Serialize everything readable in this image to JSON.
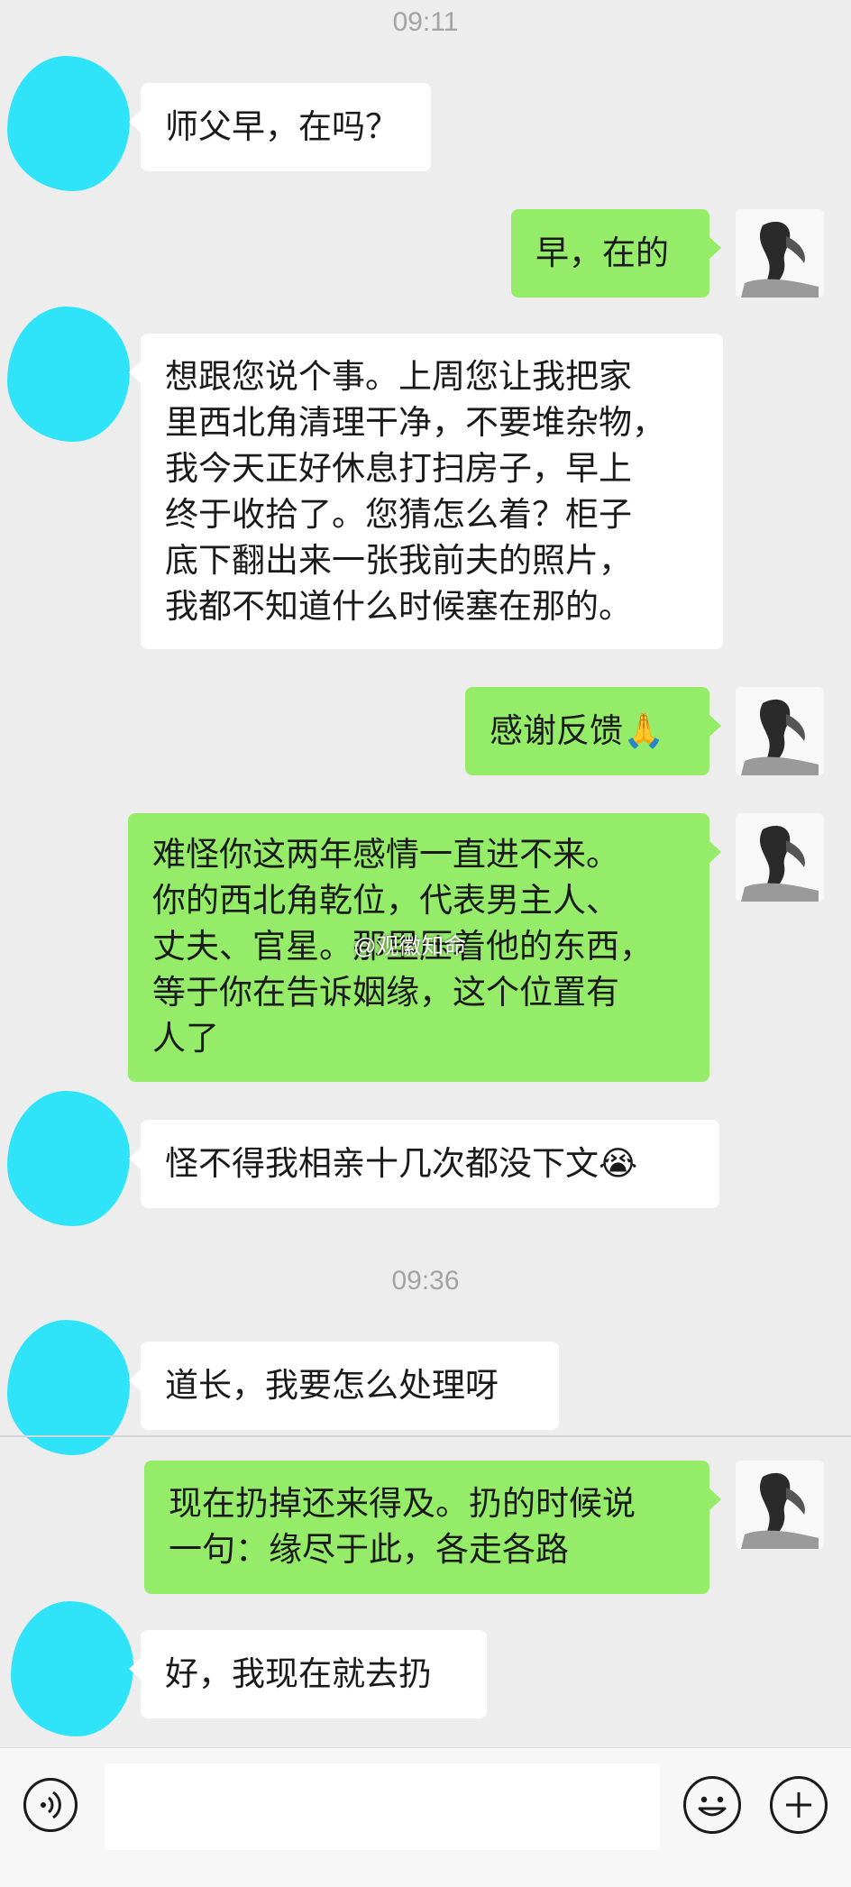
{
  "timestamps": [
    "09:11",
    "09:36"
  ],
  "messages": [
    {
      "side": "left",
      "text": "师父早，在吗？"
    },
    {
      "side": "right",
      "text": "早，在的"
    },
    {
      "side": "left",
      "text": "想跟您说个事。上周您让我把家\n里西北角清理干净，不要堆杂物，\n我今天正好休息打扫房子，早上\n终于收拾了。您猜怎么着？柜子\n底下翻出来一张我前夫的照片，\n我都不知道什么时候塞在那的。"
    },
    {
      "side": "right",
      "text": "感谢反馈🙏"
    },
    {
      "side": "right",
      "text": "难怪你这两年感情一直进不来。\n你的西北角乾位，代表男主人、\n丈夫、官星。那里压着他的东西，\n等于你在告诉姻缘，这个位置有\n人了"
    },
    {
      "side": "left",
      "text": "怪不得我相亲十几次都没下文😭"
    },
    {
      "side": "left",
      "text": "道长，我要怎么处理呀"
    },
    {
      "side": "right",
      "text": "现在扔掉还来得及。扔的时候说\n一句：缘尽于此，各走各路"
    },
    {
      "side": "left",
      "text": "好，我现在就去扔"
    }
  ],
  "watermark": "@观徽知命",
  "colors": {
    "incoming_bubble": "#ffffff",
    "outgoing_bubble": "#95ec69",
    "avatar_blob": "#2fe4f9",
    "background": "#ededed"
  },
  "bottom_bar": {
    "left_icon": "voice-icon",
    "emoji_icon": "emoji-icon",
    "plus_icon": "plus-icon"
  }
}
